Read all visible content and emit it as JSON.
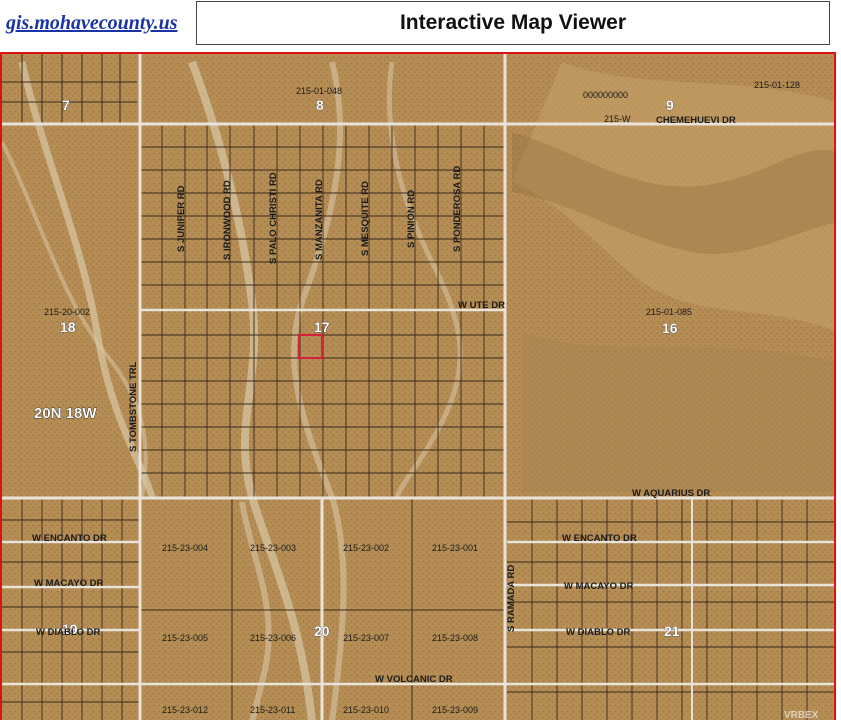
{
  "header": {
    "site_link": "gis.mohavecounty.us",
    "title": "Interactive Map Viewer"
  },
  "map": {
    "township": "20N 18W",
    "watermark": "VRBEX",
    "sections": [
      "7",
      "8",
      "9",
      "18",
      "17",
      "16",
      "19",
      "20",
      "21"
    ],
    "parcels": {
      "p_215_01_048": "215-01-048",
      "p_000000000": "000000000",
      "p_215_01_128": "215-01-128",
      "p_215_w": "215-W",
      "p_215_20_002": "215-20-002",
      "p_215_01_085": "215-01-085",
      "p_215_23_004": "215-23-004",
      "p_215_23_003": "215-23-003",
      "p_215_23_002": "215-23-002",
      "p_215_23_001": "215-23-001",
      "p_215_23_005": "215-23-005",
      "p_215_23_006": "215-23-006",
      "p_215_23_007": "215-23-007",
      "p_215_23_008": "215-23-008",
      "p_215_23_012": "215-23-012",
      "p_215_23_011": "215-23-011",
      "p_215_23_010": "215-23-010",
      "p_215_23_009": "215-23-009"
    },
    "roads": {
      "chemehuevi": "CHEMEHUEVI DR",
      "juniper": "S JUNIPER RD",
      "ironwood": "S IRONWOOD RD",
      "palo_christi": "S PALO CHRISTI RD",
      "manzanita": "S MANZANITA RD",
      "mesquite": "S MESQUITE RD",
      "pinion": "S PINION RD",
      "ponderosa": "S PONDEROSA RD",
      "ute": "W UTE DR",
      "tombstone": "S TOMBSTONE TRL",
      "aquarius": "W AQUARIUS DR",
      "encanto_left": "W ENCANTO DR",
      "encanto_right": "W ENCANTO DR",
      "macayo_left": "W MACAYO DR",
      "macayo_right": "W MACAYO DR",
      "diablo_left": "W DIABLO DR",
      "diablo_right": "W DIABLO DR",
      "ramada": "S RAMADA RD",
      "volcanic": "W VOLCANIC DR"
    },
    "colors": {
      "terrain": "#b58d55",
      "terrain_dark": "#9c7442",
      "wash": "#d8c7a6",
      "parcel_line": "#3a2a1a",
      "road": "#e8e4da",
      "highlight": "#d2223a",
      "frame": "#dd1111"
    }
  }
}
